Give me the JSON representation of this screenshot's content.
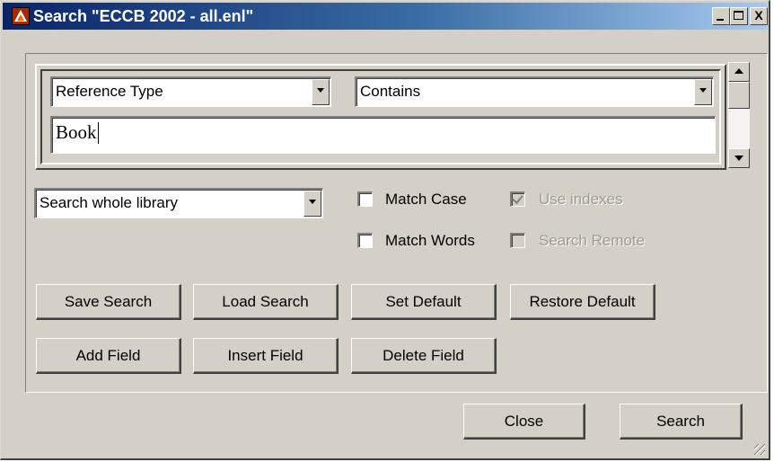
{
  "window": {
    "title": "Search \"ECCB 2002 - all.enl\"",
    "controls": {
      "minimize": "_",
      "maximize": "□",
      "close": "X"
    }
  },
  "criteria": {
    "field_select": "Reference Type",
    "operator_select": "Contains",
    "search_text": "Book"
  },
  "scope_select": "Search whole library",
  "options": {
    "match_case": {
      "label": "Match Case",
      "checked": false,
      "enabled": true
    },
    "match_words": {
      "label": "Match Words",
      "checked": false,
      "enabled": true
    },
    "use_indexes": {
      "label": "Use indexes",
      "checked": true,
      "enabled": false
    },
    "search_remote": {
      "label": "Search Remote",
      "checked": false,
      "enabled": false
    }
  },
  "buttons": {
    "save_search": "Save Search",
    "load_search": "Load Search",
    "set_default": "Set Default",
    "restore_default": "Restore Default",
    "add_field": "Add Field",
    "insert_field": "Insert Field",
    "delete_field": "Delete Field",
    "close": "Close",
    "search": "Search"
  },
  "colors": {
    "face": "#d4d0c8",
    "title_start": "#0a246a",
    "title_end": "#a6caf0",
    "disabled_text": "#9c9a94"
  },
  "icons": {
    "app": "endnote-app-icon",
    "dropdown": "chevron-down-icon",
    "scroll_up": "arrow-up-icon",
    "scroll_down": "arrow-down-icon"
  }
}
